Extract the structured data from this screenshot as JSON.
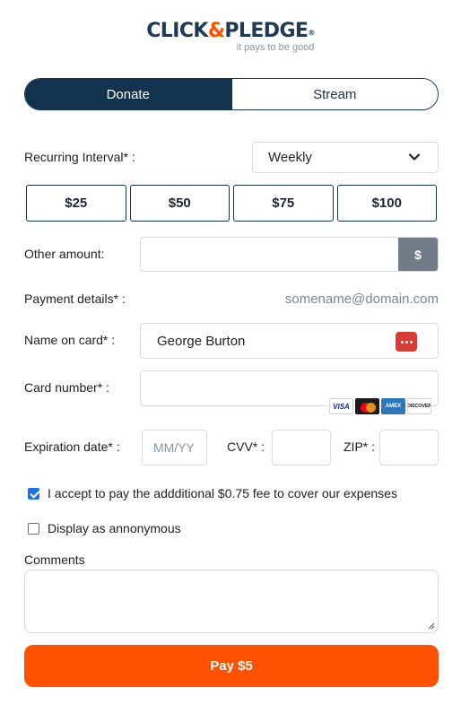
{
  "logo": {
    "main_left": "CLICK",
    "amp": "&",
    "main_right": "PLEDGE",
    "reg": "®",
    "tagline": "it pays to be good"
  },
  "tabs": [
    {
      "label": "Donate",
      "active": true
    },
    {
      "label": "Stream",
      "active": false
    }
  ],
  "recurring": {
    "label": "Recurring Interval* :",
    "selected": "Weekly"
  },
  "amounts": [
    "$25",
    "$50",
    "$75",
    "$100"
  ],
  "other_amount": {
    "label": "Other amount:",
    "value": "",
    "currency_symbol": "$"
  },
  "payment_details": {
    "label": "Payment details* :",
    "email": "somename@domain.com"
  },
  "name_on_card": {
    "label": "Name on card* :",
    "value": "George Burton"
  },
  "card_number": {
    "label": "Card number* :",
    "value": "",
    "brands": [
      "VISA",
      "Mastercard",
      "AMEX",
      "DISCOVER"
    ]
  },
  "expiration": {
    "label": "Expiration date* :",
    "placeholder": "MM/YY"
  },
  "cvv": {
    "label": "CVV* :",
    "value": ""
  },
  "zip": {
    "label": "ZIP* :",
    "value": ""
  },
  "fee_checkbox": {
    "label": "I accept to pay the addditional $0.75 fee to cover our expenses",
    "checked": true
  },
  "anon_checkbox": {
    "label": "Display as annonymous",
    "checked": false
  },
  "comments": {
    "label": "Comments",
    "value": ""
  },
  "pay_button": {
    "label": "Pay $5"
  },
  "colors": {
    "navy": "#12324e",
    "orange": "#ff5200",
    "grey_button": "#707c87",
    "check_blue": "#1a73e8"
  }
}
